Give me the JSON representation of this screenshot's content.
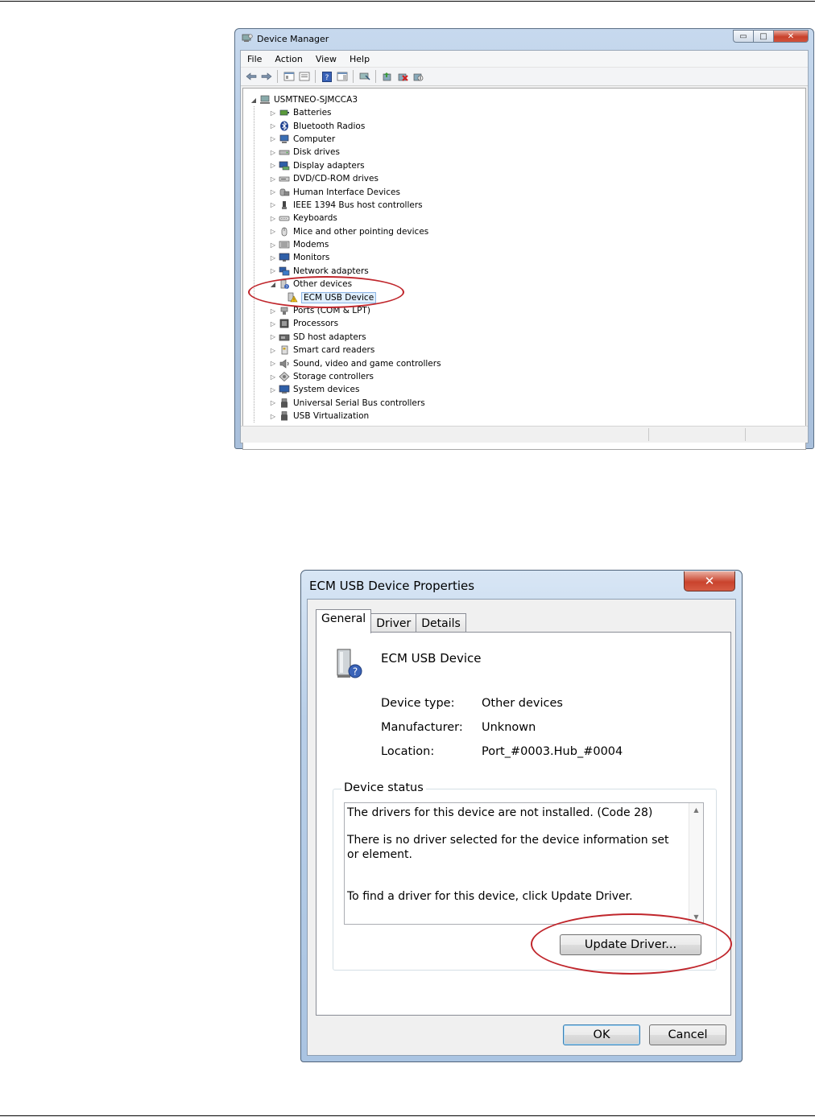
{
  "device_manager": {
    "title": "Device Manager",
    "controls": {
      "minimize": "▭",
      "maximize": "□",
      "close": "✕"
    },
    "menu": [
      "File",
      "Action",
      "View",
      "Help"
    ],
    "toolbar_icons": [
      "back-arrow-icon",
      "forward-arrow-icon",
      "show-hide-tree-icon",
      "properties-icon",
      "help-icon",
      "action-pane-icon",
      "update-driver-icon",
      "uninstall-icon",
      "disable-icon",
      "scan-hardware-icon"
    ],
    "tree": {
      "root": "USMTNEO-SJMCCA3",
      "categories": [
        {
          "label": "Batteries",
          "icon": "battery-icon"
        },
        {
          "label": "Bluetooth Radios",
          "icon": "bluetooth-icon"
        },
        {
          "label": "Computer",
          "icon": "computer-icon"
        },
        {
          "label": "Disk drives",
          "icon": "disk-icon"
        },
        {
          "label": "Display adapters",
          "icon": "display-adapter-icon"
        },
        {
          "label": "DVD/CD-ROM drives",
          "icon": "dvd-icon"
        },
        {
          "label": "Human Interface Devices",
          "icon": "hid-icon"
        },
        {
          "label": "IEEE 1394 Bus host controllers",
          "icon": "firewire-icon"
        },
        {
          "label": "Keyboards",
          "icon": "keyboard-icon"
        },
        {
          "label": "Mice and other pointing devices",
          "icon": "mouse-icon"
        },
        {
          "label": "Modems",
          "icon": "modem-icon"
        },
        {
          "label": "Monitors",
          "icon": "monitor-icon"
        },
        {
          "label": "Network adapters",
          "icon": "network-icon"
        },
        {
          "label": "Other devices",
          "icon": "other-devices-icon",
          "expanded": true,
          "children": [
            {
              "label": "ECM USB Device",
              "icon": "warning-device-icon",
              "selected": true
            }
          ]
        },
        {
          "label": "Ports (COM & LPT)",
          "icon": "port-icon"
        },
        {
          "label": "Processors",
          "icon": "processor-icon"
        },
        {
          "label": "SD host adapters",
          "icon": "sd-icon"
        },
        {
          "label": "Smart card readers",
          "icon": "smartcard-icon"
        },
        {
          "label": "Sound, video and game controllers",
          "icon": "sound-icon"
        },
        {
          "label": "Storage controllers",
          "icon": "storage-icon"
        },
        {
          "label": "System devices",
          "icon": "system-icon"
        },
        {
          "label": "Universal Serial Bus controllers",
          "icon": "usb-icon"
        },
        {
          "label": "USB Virtualization",
          "icon": "usb-icon"
        }
      ]
    }
  },
  "properties_dialog": {
    "title": "ECM USB Device Properties",
    "close_glyph": "✕",
    "tabs": [
      "General",
      "Driver",
      "Details"
    ],
    "active_tab": "General",
    "device_name": "ECM USB Device",
    "fields": [
      {
        "key": "Device type:",
        "value": "Other devices"
      },
      {
        "key": "Manufacturer:",
        "value": "Unknown"
      },
      {
        "key": "Location:",
        "value": "Port_#0003.Hub_#0004"
      }
    ],
    "status_group_label": "Device status",
    "status_lines": [
      "The drivers for this device are not installed. (Code 28)",
      "There is no driver selected for the device information set or element.",
      "To find a driver for this device, click Update Driver."
    ],
    "update_driver_label": "Update Driver...",
    "ok_label": "OK",
    "cancel_label": "Cancel"
  },
  "colors": {
    "highlight_ring": "#c0262c",
    "selection": "#dfeefc"
  }
}
